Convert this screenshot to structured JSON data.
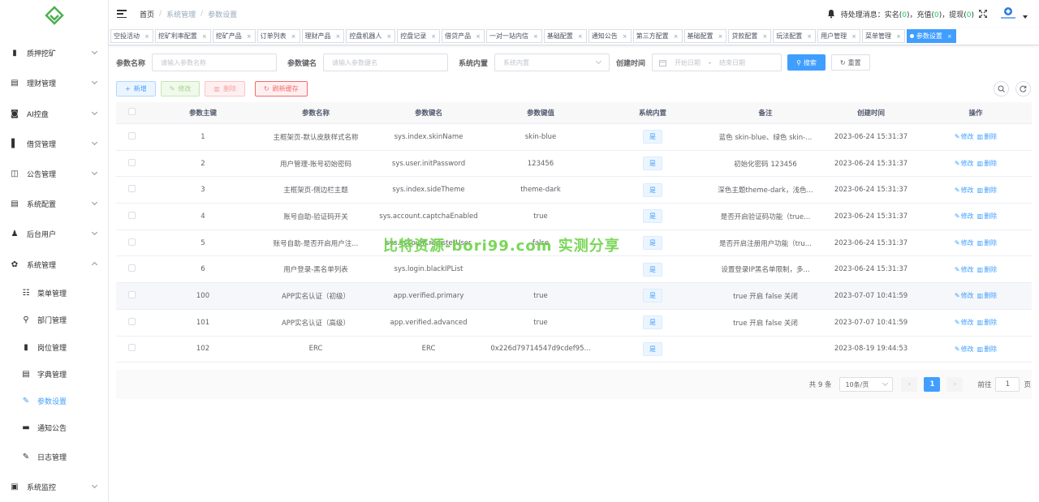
{
  "sidebar": {
    "items": [
      {
        "label": "质押挖矿",
        "icon": "bar-chart-icon",
        "glyph": "▮",
        "chevron": "down"
      },
      {
        "label": "理财管理",
        "icon": "document-icon",
        "glyph": "▤",
        "chevron": "down"
      },
      {
        "label": "AI控盘",
        "icon": "robot-icon",
        "glyph": "◙",
        "chevron": "down"
      },
      {
        "label": "借贷管理",
        "icon": "book-icon",
        "glyph": "▌",
        "chevron": "down"
      },
      {
        "label": "公告管理",
        "icon": "open-book-icon",
        "glyph": "◫",
        "chevron": "down"
      },
      {
        "label": "系统配置",
        "icon": "config-icon",
        "glyph": "▤",
        "chevron": "down"
      },
      {
        "label": "后台用户",
        "icon": "users-icon",
        "glyph": "♟",
        "chevron": "down"
      },
      {
        "label": "系统管理",
        "icon": "gear-icon",
        "glyph": "✿",
        "chevron": "up"
      }
    ],
    "submenu": [
      {
        "label": "菜单管理",
        "icon": "tree-table-icon",
        "glyph": "☷",
        "active": false
      },
      {
        "label": "部门管理",
        "icon": "tree-icon",
        "glyph": "⚲",
        "active": false
      },
      {
        "label": "岗位管理",
        "icon": "post-icon",
        "glyph": "▮",
        "active": false
      },
      {
        "label": "字典管理",
        "icon": "dict-icon",
        "glyph": "▤",
        "active": false
      },
      {
        "label": "参数设置",
        "icon": "edit-icon",
        "glyph": "✎",
        "active": true
      },
      {
        "label": "通知公告",
        "icon": "message-icon",
        "glyph": "▬",
        "active": false
      },
      {
        "label": "日志管理",
        "icon": "log-icon",
        "glyph": "✎",
        "active": false,
        "chevron": "down"
      }
    ],
    "bottom": {
      "label": "系统监控",
      "icon": "monitor-icon",
      "glyph": "▣",
      "chevron": "down"
    }
  },
  "header": {
    "breadcrumb": [
      "首页",
      "系统管理",
      "参数设置"
    ],
    "notice_prefix": "待处理消息：实名(",
    "notice_realname": "0",
    "notice_mid1": ")，充值(",
    "notice_recharge": "0",
    "notice_mid2": ")，提现(",
    "notice_withdraw": "0",
    "notice_suffix": ")"
  },
  "tags": [
    {
      "label": "空投活动",
      "active": false
    },
    {
      "label": "挖矿利率配置",
      "active": false
    },
    {
      "label": "挖矿产品",
      "active": false
    },
    {
      "label": "订单列表",
      "active": false
    },
    {
      "label": "理财产品",
      "active": false
    },
    {
      "label": "控盘机器人",
      "active": false
    },
    {
      "label": "控盘记录",
      "active": false
    },
    {
      "label": "借贷产品",
      "active": false
    },
    {
      "label": "一对一站内信",
      "active": false
    },
    {
      "label": "基础配置",
      "active": false
    },
    {
      "label": "通知公告",
      "active": false
    },
    {
      "label": "第三方配置",
      "active": false
    },
    {
      "label": "基础配置",
      "active": false
    },
    {
      "label": "贷款配置",
      "active": false
    },
    {
      "label": "玩法配置",
      "active": false
    },
    {
      "label": "用户管理",
      "active": false
    },
    {
      "label": "菜单管理",
      "active": false
    },
    {
      "label": "参数设置",
      "active": true
    }
  ],
  "search": {
    "name_label": "参数名称",
    "name_placeholder": "请输入参数名称",
    "key_label": "参数键名",
    "key_placeholder": "请输入参数键名",
    "builtin_label": "系统内置",
    "builtin_placeholder": "系统内置",
    "time_label": "创建时间",
    "start_placeholder": "开始日期",
    "range_sep": "-",
    "end_placeholder": "结束日期",
    "search_btn": "搜索",
    "reset_btn": "重置"
  },
  "toolbar": {
    "add": "新增",
    "edit": "修改",
    "delete": "删除",
    "refresh": "刷新缓存"
  },
  "table": {
    "columns": [
      "参数主键",
      "参数名称",
      "参数键名",
      "参数键值",
      "系统内置",
      "备注",
      "创建时间",
      "操作"
    ],
    "rows": [
      {
        "id": "1",
        "name": "主框架页-默认皮肤样式名称",
        "key": "sys.index.skinName",
        "value": "skin-blue",
        "builtin": "是",
        "remark": "蓝色 skin-blue、绿色 skin-...",
        "time": "2023-06-24 15:31:37"
      },
      {
        "id": "2",
        "name": "用户管理-账号初始密码",
        "key": "sys.user.initPassword",
        "value": "123456",
        "builtin": "是",
        "remark": "初始化密码 123456",
        "time": "2023-06-24 15:31:37"
      },
      {
        "id": "3",
        "name": "主框架页-侧边栏主题",
        "key": "sys.index.sideTheme",
        "value": "theme-dark",
        "builtin": "是",
        "remark": "深色主题theme-dark，浅色...",
        "time": "2023-06-24 15:31:37"
      },
      {
        "id": "4",
        "name": "账号自助-验证码开关",
        "key": "sys.account.captchaEnabled",
        "value": "true",
        "builtin": "是",
        "remark": "是否开启验证码功能（true...",
        "time": "2023-06-24 15:31:37"
      },
      {
        "id": "5",
        "name": "账号自助-是否开启用户注...",
        "key": "sys.account.registerUser",
        "value": "false",
        "builtin": "是",
        "remark": "是否开启注册用户功能（tru...",
        "time": "2023-06-24 15:31:37"
      },
      {
        "id": "6",
        "name": "用户登录-黑名单列表",
        "key": "sys.login.blackIPList",
        "value": "",
        "builtin": "是",
        "remark": "设置登录IP黑名单限制，多...",
        "time": "2023-06-24 15:31:37"
      },
      {
        "id": "100",
        "name": "APP实名认证（初级）",
        "key": "app.verified.primary",
        "value": "true",
        "builtin": "是",
        "remark": "true 开启 false 关闭",
        "time": "2023-07-07 10:41:59"
      },
      {
        "id": "101",
        "name": "APP实名认证（高级）",
        "key": "app.verified.advanced",
        "value": "true",
        "builtin": "是",
        "remark": "true 开启 false 关闭",
        "time": "2023-07-07 10:41:59"
      },
      {
        "id": "102",
        "name": "ERC",
        "key": "ERC",
        "value": "0x226d79714547d9cdef95...",
        "builtin": "是",
        "remark": "",
        "time": "2023-08-19 19:44:53"
      }
    ],
    "op_edit": "修改",
    "op_delete": "删除"
  },
  "pagination": {
    "total": "共 9 条",
    "page_size": "10条/页",
    "current": "1",
    "goto_label": "前往",
    "goto_value": "1",
    "page_suffix": "页"
  },
  "watermark": "比特资源-bori99.com 实测分享",
  "colors": {
    "primary": "#409eff",
    "success": "#13ce66",
    "danger": "#f56c6c",
    "logo": "#4caf50"
  }
}
